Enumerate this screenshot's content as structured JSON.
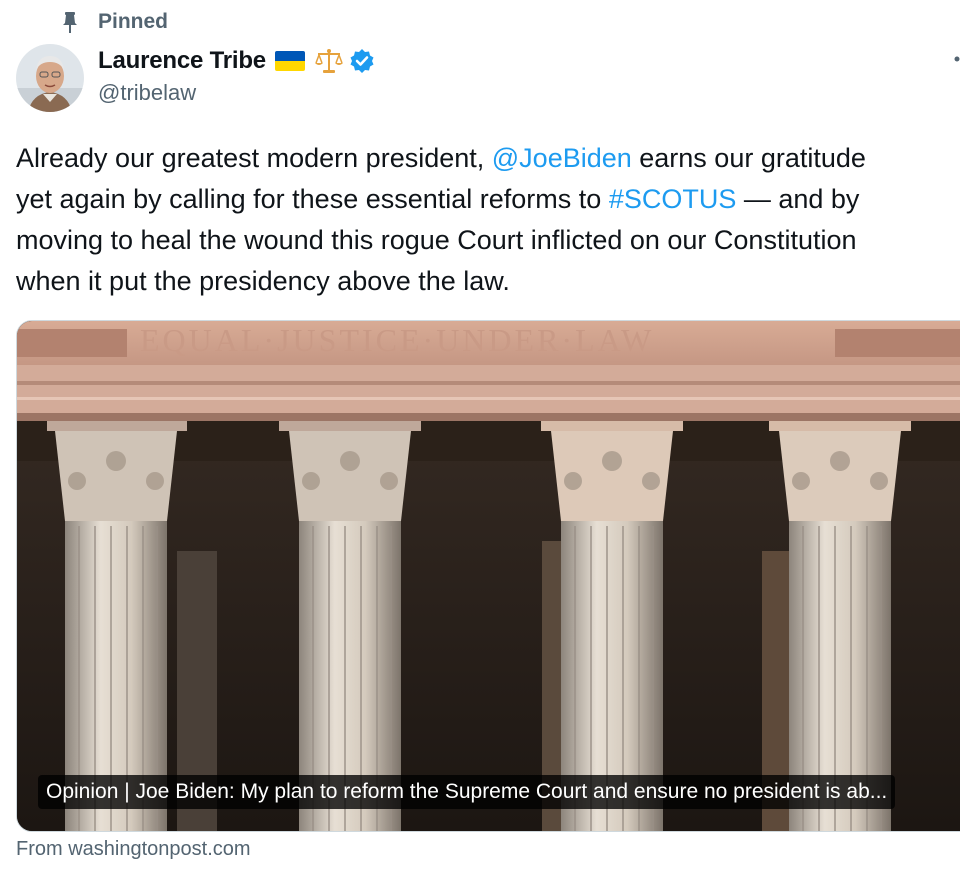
{
  "pinned": {
    "label": "Pinned",
    "icon": "pin-icon"
  },
  "author": {
    "display_name": "Laurence Tribe",
    "handle": "@tribelaw",
    "badges": [
      "ukraine-flag-icon",
      "scales-icon",
      "verified-icon"
    ],
    "verified_color": "#1d9bf0"
  },
  "tweet": {
    "seg1": "Already our greatest modern president, ",
    "mention": "@JoeBiden",
    "seg2": " earns our gratitude",
    "seg3": "yet again by calling for these essential reforms to ",
    "hashtag": "#SCOTUS",
    "seg4": " — and by",
    "line3": "moving to heal the wound this rogue Court inflicted on our Constitution",
    "line4": "when it put the presidency above the law."
  },
  "card": {
    "engraving": "EQUAL·JUSTICE·UNDER·LAW",
    "caption": "Opinion | Joe Biden: My plan to reform the Supreme Court and ensure no president is ab...",
    "source": "From washingtonpost.com"
  },
  "colors": {
    "link": "#1d9bf0",
    "secondary_text": "#536471",
    "primary_text": "#0f1419"
  }
}
